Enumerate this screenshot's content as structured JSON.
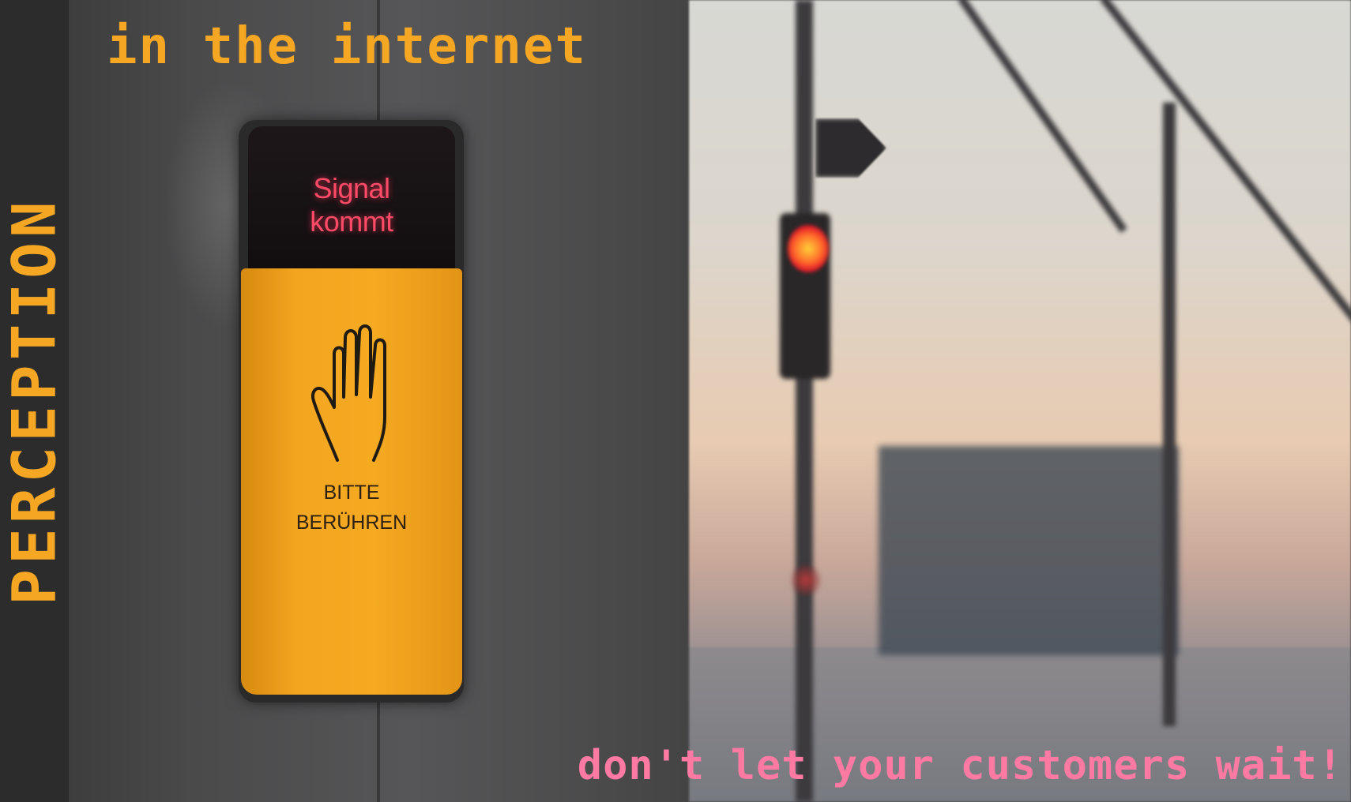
{
  "side_label": "PERCEPTION",
  "headline": "in the internet",
  "tagline": "don't let your customers wait!",
  "button": {
    "display_line_1": "Signal",
    "display_line_2": "kommt",
    "panel_line_1": "BITTE",
    "panel_line_2": "BERÜHREN"
  },
  "colors": {
    "accent_orange": "#f5a623",
    "accent_pink": "#ff7aa3",
    "display_red": "#ff4a68",
    "side_band": "#2c2c2c"
  }
}
